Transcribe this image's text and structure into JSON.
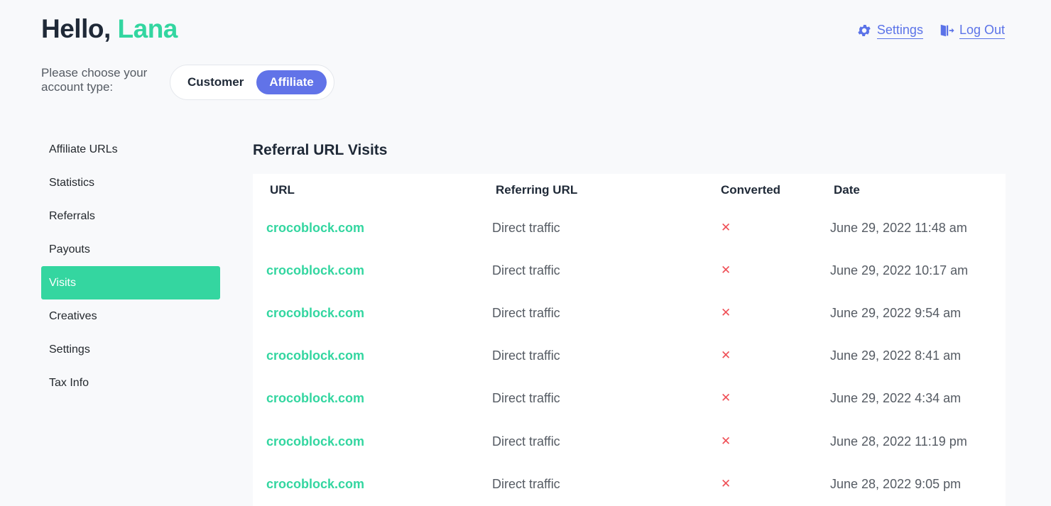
{
  "header": {
    "greeting_prefix": "Hello, ",
    "user_name": "Lana",
    "settings_label": "Settings",
    "logout_label": "Log Out"
  },
  "account_type": {
    "prompt": "Please choose your account type:",
    "options": [
      "Customer",
      "Affiliate"
    ],
    "selected": "Affiliate"
  },
  "sidebar": {
    "items": [
      {
        "label": "Affiliate URLs"
      },
      {
        "label": "Statistics"
      },
      {
        "label": "Referrals"
      },
      {
        "label": "Payouts"
      },
      {
        "label": "Visits"
      },
      {
        "label": "Creatives"
      },
      {
        "label": "Settings"
      },
      {
        "label": "Tax Info"
      }
    ],
    "active": "Visits"
  },
  "main": {
    "title": "Referral URL Visits",
    "columns": [
      "URL",
      "Referring URL",
      "Converted",
      "Date"
    ],
    "rows": [
      {
        "url": "crocoblock.com",
        "referring": "Direct traffic",
        "converted": "✕",
        "date": "June 29, 2022 11:48 am"
      },
      {
        "url": "crocoblock.com",
        "referring": "Direct traffic",
        "converted": "✕",
        "date": "June 29, 2022 10:17 am"
      },
      {
        "url": "crocoblock.com",
        "referring": "Direct traffic",
        "converted": "✕",
        "date": "June 29, 2022 9:54 am"
      },
      {
        "url": "crocoblock.com",
        "referring": "Direct traffic",
        "converted": "✕",
        "date": "June 29, 2022 8:41 am"
      },
      {
        "url": "crocoblock.com",
        "referring": "Direct traffic",
        "converted": "✕",
        "date": "June 29, 2022 4:34 am"
      },
      {
        "url": "crocoblock.com",
        "referring": "Direct traffic",
        "converted": "✕",
        "date": "June 28, 2022 11:19 pm"
      },
      {
        "url": "crocoblock.com",
        "referring": "Direct traffic",
        "converted": "✕",
        "date": "June 28, 2022 9:05 pm"
      }
    ]
  },
  "icons": {
    "settings": "gear-icon",
    "logout": "door-exit-icon"
  },
  "colors": {
    "accent_green": "#33d6a0",
    "accent_blue": "#5b73e8",
    "toggle_active": "#6173e8",
    "not_converted": "#ef4f56"
  }
}
